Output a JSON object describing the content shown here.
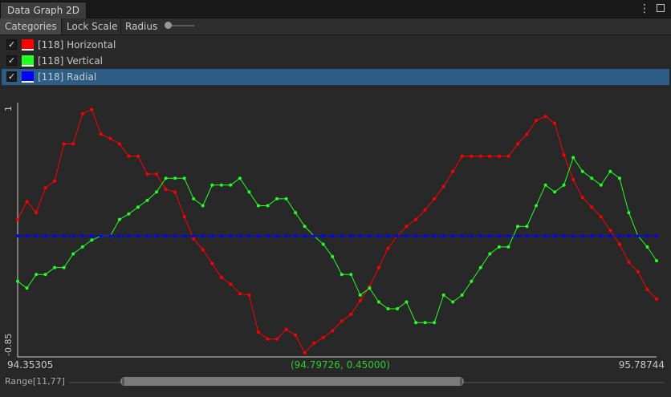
{
  "window": {
    "tab_title": "Data Graph 2D",
    "menu_icon": "kebab-menu-icon",
    "maximize_icon": "maximize-icon"
  },
  "toolbar": {
    "categories_label": "Categories",
    "lock_scale_label": "Lock Scale",
    "radius_label": "Radius",
    "radius_value": "2"
  },
  "series_list": [
    {
      "label": "[118] Horizontal",
      "color": "#ff0000",
      "checked": true,
      "selected": false
    },
    {
      "label": "[118] Vertical",
      "color": "#22ff22",
      "checked": true,
      "selected": false
    },
    {
      "label": "[118] Radial",
      "color": "#0000ff",
      "checked": true,
      "selected": true
    }
  ],
  "graph": {
    "x_min_label": "94.35305",
    "x_max_label": "95.78744",
    "y_max_label": "1",
    "y_min_label": "-0.85",
    "cursor_readout": "(94.79726, 0.45000)"
  },
  "range": {
    "label": "Range[11,77]",
    "start_fraction": 0.086,
    "end_fraction": 0.663
  },
  "chart_data": {
    "type": "line",
    "xlim": [
      94.35305,
      95.78744
    ],
    "ylim": [
      -0.85,
      1
    ],
    "grid": false,
    "cursor": {
      "x": 94.79726,
      "y": 0.45
    },
    "series": [
      {
        "name": "[118] Horizontal",
        "color": "#ff0000",
        "values": [
          0.15,
          0.28,
          0.2,
          0.38,
          0.43,
          0.7,
          0.7,
          0.92,
          0.95,
          0.77,
          0.74,
          0.7,
          0.61,
          0.61,
          0.48,
          0.48,
          0.37,
          0.35,
          0.17,
          0.01,
          -0.07,
          -0.17,
          -0.27,
          -0.32,
          -0.39,
          -0.4,
          -0.67,
          -0.72,
          -0.72,
          -0.65,
          -0.69,
          -0.82,
          -0.75,
          -0.71,
          -0.66,
          -0.59,
          -0.54,
          -0.44,
          -0.34,
          -0.2,
          -0.06,
          0.03,
          0.1,
          0.15,
          0.22,
          0.3,
          0.39,
          0.5,
          0.61,
          0.61,
          0.61,
          0.61,
          0.61,
          0.61,
          0.7,
          0.77,
          0.87,
          0.9,
          0.85,
          0.62,
          0.44,
          0.31,
          0.24,
          0.17,
          0.07,
          -0.03,
          -0.16,
          -0.23,
          -0.36,
          -0.43
        ]
      },
      {
        "name": "[118] Vertical",
        "color": "#22ff22",
        "values": [
          -0.3,
          -0.35,
          -0.25,
          -0.25,
          -0.2,
          -0.2,
          -0.1,
          -0.05,
          0,
          0.03,
          0.03,
          0.15,
          0.19,
          0.24,
          0.29,
          0.35,
          0.45,
          0.45,
          0.45,
          0.3,
          0.25,
          0.4,
          0.4,
          0.4,
          0.45,
          0.35,
          0.25,
          0.25,
          0.3,
          0.3,
          0.2,
          0.1,
          0.03,
          -0.03,
          -0.12,
          -0.25,
          -0.25,
          -0.4,
          -0.35,
          -0.45,
          -0.5,
          -0.5,
          -0.45,
          -0.6,
          -0.6,
          -0.6,
          -0.4,
          -0.45,
          -0.4,
          -0.3,
          -0.2,
          -0.1,
          -0.05,
          -0.05,
          0.1,
          0.1,
          0.25,
          0.4,
          0.35,
          0.4,
          0.6,
          0.5,
          0.45,
          0.4,
          0.5,
          0.45,
          0.2,
          0.03,
          -0.05,
          -0.15
        ]
      },
      {
        "name": "[118] Radial",
        "color": "#0000ff",
        "values": [
          0.03,
          0.03,
          0.03,
          0.03,
          0.03,
          0.03,
          0.03,
          0.03,
          0.03,
          0.03,
          0.03,
          0.03,
          0.03,
          0.03,
          0.03,
          0.03,
          0.03,
          0.03,
          0.03,
          0.03,
          0.03,
          0.03,
          0.03,
          0.03,
          0.03,
          0.03,
          0.03,
          0.03,
          0.03,
          0.03,
          0.03,
          0.03,
          0.03,
          0.03,
          0.03,
          0.03,
          0.03,
          0.03,
          0.03,
          0.03,
          0.03,
          0.03,
          0.03,
          0.03,
          0.03,
          0.03,
          0.03,
          0.03,
          0.03,
          0.03,
          0.03,
          0.03,
          0.03,
          0.03,
          0.03,
          0.03,
          0.03,
          0.03,
          0.03,
          0.03,
          0.03,
          0.03,
          0.03,
          0.03,
          0.03,
          0.03,
          0.03,
          0.03,
          0.03,
          0.03
        ]
      }
    ]
  }
}
